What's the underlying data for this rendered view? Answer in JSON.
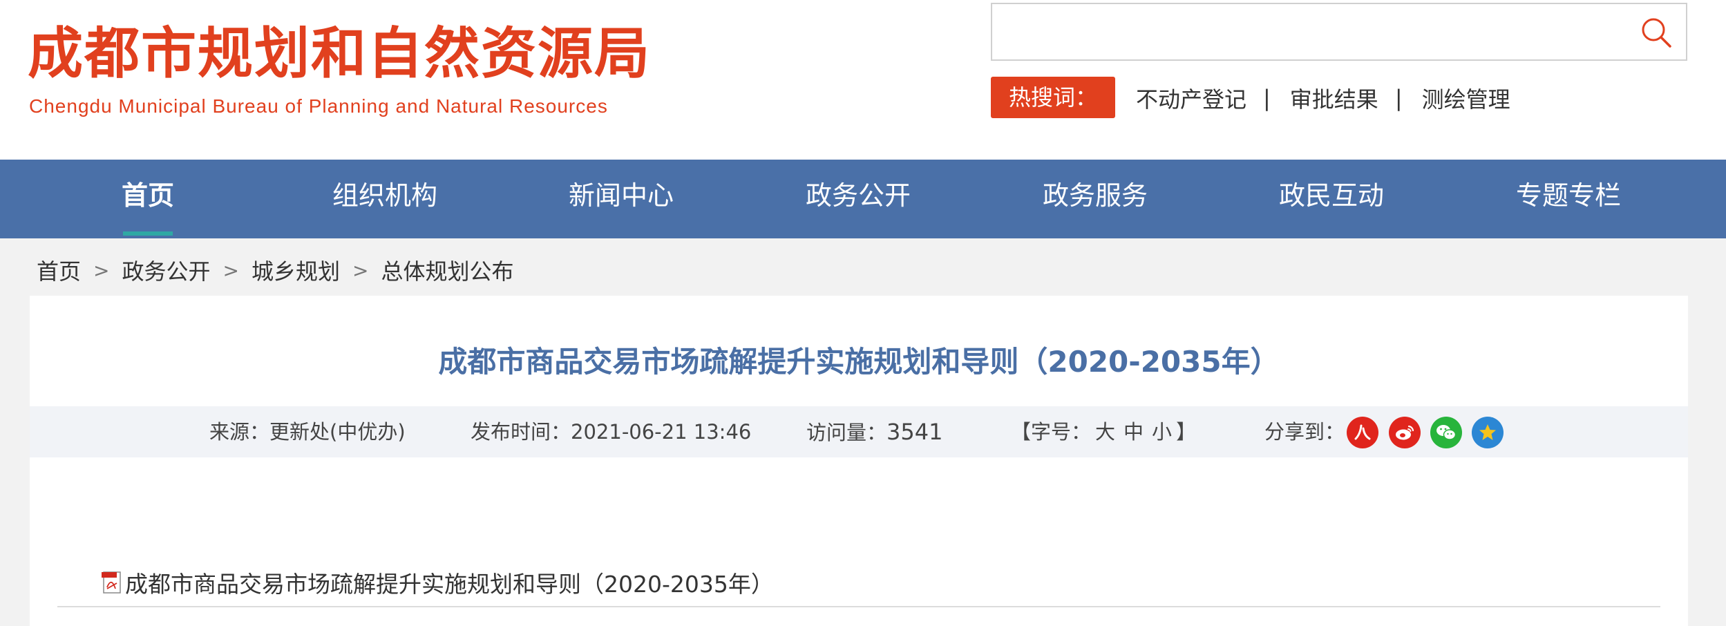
{
  "header": {
    "logo_cn": "成都市规划和自然资源局",
    "logo_en": "Chengdu Municipal Bureau of Planning and Natural Resources",
    "search": {
      "placeholder": "",
      "value": ""
    },
    "hot_label": "热搜词：",
    "hot_links": [
      "不动产登记",
      "审批结果",
      "测绘管理"
    ],
    "hot_separator": "|"
  },
  "nav": {
    "items": [
      "首页",
      "组织机构",
      "新闻中心",
      "政务公开",
      "政务服务",
      "政民互动",
      "专题专栏"
    ],
    "active": "首页"
  },
  "breadcrumb": {
    "items": [
      "首页",
      "政务公开",
      "城乡规划",
      "总体规划公布"
    ],
    "separator": ">"
  },
  "article": {
    "title": "成都市商品交易市场疏解提升实施规划和导则（2020-2035年）",
    "source_label": "来源：",
    "source_value": "更新处(中优办)",
    "date_label": "发布时间：",
    "date_value": "2021-06-21 13:46",
    "views_label": "访问量：",
    "views_value": "3541",
    "font_open": "【字号：",
    "font_sizes": [
      "大",
      "中",
      "小"
    ],
    "font_close": "】",
    "share_label": "分享到：",
    "attachment": "成都市商品交易市场疏解提升实施规划和导则（2020-2035年）"
  },
  "colors": {
    "brand_red": "#e1401e",
    "nav_blue": "#4a70a8",
    "title_blue": "#4a6fa5",
    "active_underline": "#2fa8a4"
  },
  "icons": [
    "search-icon",
    "renren-share-icon",
    "weibo-share-icon",
    "wechat-share-icon",
    "qzone-share-icon",
    "pdf-icon"
  ]
}
